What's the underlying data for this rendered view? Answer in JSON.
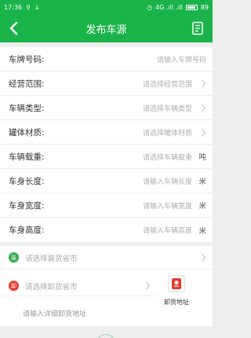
{
  "statusbar": {
    "time": "17:36",
    "signal_text": "4G .ıll .ıll",
    "battery": "89",
    "battery_level": 0.89
  },
  "header": {
    "title": "发布车源"
  },
  "form": {
    "rows": [
      {
        "label": "车牌号码:",
        "value": "请输入车牌号码",
        "suffix": "",
        "chevron": false
      },
      {
        "label": "经营范围:",
        "value": "请选择经营范围",
        "suffix": "",
        "chevron": true
      },
      {
        "label": "车辆类型:",
        "value": "请选择车辆类型",
        "suffix": "",
        "chevron": true
      },
      {
        "label": "罐体材质:",
        "value": "请选择罐体材质",
        "suffix": "",
        "chevron": true
      },
      {
        "label": "车辆载重:",
        "value": "请选择车辆载重",
        "suffix": "吨",
        "chevron": false
      },
      {
        "label": "车身长度:",
        "value": "请输入车辆长度",
        "suffix": "米",
        "chevron": false
      },
      {
        "label": "车身宽度:",
        "value": "请输入车辆宽度",
        "suffix": "米",
        "chevron": false
      },
      {
        "label": "车身高度:",
        "value": "请输入车辆高度",
        "suffix": "米",
        "chevron": false
      }
    ]
  },
  "address": {
    "load_pin": "装",
    "load_placeholder": "请选择装货省市",
    "unload_pin": "卸",
    "unload_placeholder": "请选择卸货省市",
    "detail_placeholder": "请输入详细卸货地址",
    "unload_button_label": "卸货地址"
  },
  "colors": {
    "brand": "#1ab34a",
    "pin_green": "#2fae4c",
    "pin_red": "#e63b2e"
  }
}
